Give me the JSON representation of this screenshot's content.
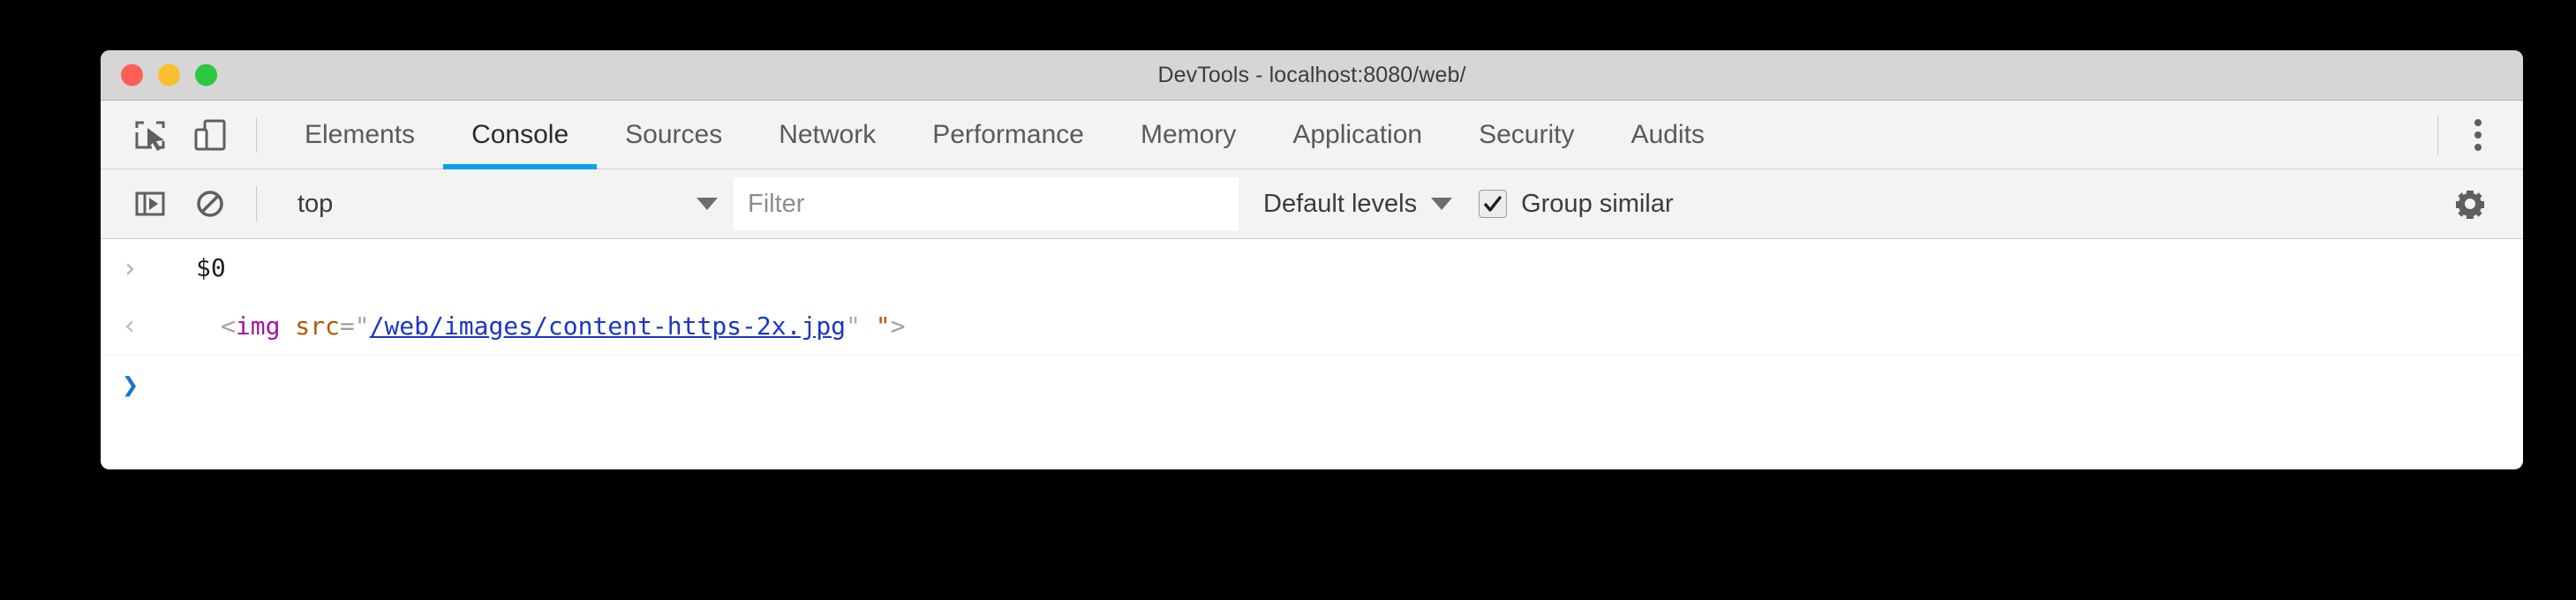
{
  "window": {
    "title": "DevTools - localhost:8080/web/",
    "traffic_lights": [
      {
        "name": "close",
        "color": "#ff5f57"
      },
      {
        "name": "minimize",
        "color": "#fbbe30"
      },
      {
        "name": "maximize",
        "color": "#2bc840"
      }
    ]
  },
  "tab_bar": {
    "icons": [
      {
        "name": "inspect-element-icon",
        "label": "Inspect element"
      },
      {
        "name": "device-toolbar-icon",
        "label": "Toggle device toolbar"
      }
    ],
    "tabs": [
      {
        "label": "Elements",
        "active": false
      },
      {
        "label": "Console",
        "active": true
      },
      {
        "label": "Sources",
        "active": false
      },
      {
        "label": "Network",
        "active": false
      },
      {
        "label": "Performance",
        "active": false
      },
      {
        "label": "Memory",
        "active": false
      },
      {
        "label": "Application",
        "active": false
      },
      {
        "label": "Security",
        "active": false
      },
      {
        "label": "Audits",
        "active": false
      }
    ],
    "more_button": "kebab-menu",
    "active_underline_color": "#0aa1e8"
  },
  "console_toolbar": {
    "sidebar_toggle": "show-console-sidebar-icon",
    "clear_console": "clear-console-icon",
    "context": {
      "value": "top",
      "caret": "chevron-down-icon"
    },
    "filter": {
      "value": "",
      "placeholder": "Filter"
    },
    "levels": {
      "value": "Default levels",
      "caret": "chevron-down-icon"
    },
    "group_similar": {
      "label": "Group similar",
      "checked": true,
      "checkmark": "✔"
    },
    "settings": "gear-icon"
  },
  "console": {
    "rows": [
      {
        "type": "input",
        "prompt": "›",
        "text": "$0"
      },
      {
        "type": "result",
        "prompt": "‹",
        "tokens": [
          {
            "cls": "tok-punct",
            "text": "<"
          },
          {
            "cls": "tok-tag",
            "text": "img"
          },
          {
            "cls": "tok-punct",
            "text": " "
          },
          {
            "cls": "tok-attr",
            "text": "src"
          },
          {
            "cls": "tok-eq",
            "text": "="
          },
          {
            "cls": "tok-quote",
            "text": "\""
          },
          {
            "cls": "tok-link",
            "text": "/web/images/content-https-2x.jpg"
          },
          {
            "cls": "tok-quote",
            "text": "\""
          },
          {
            "cls": "tok-punct",
            "text": " "
          },
          {
            "cls": "tok-quote2",
            "text": "\""
          },
          {
            "cls": "tok-punct",
            "text": ">"
          }
        ],
        "plain": "<img src=\"/web/images/content-https-2x.jpg\" \">"
      },
      {
        "type": "prompt",
        "prompt": "❯",
        "text": ""
      }
    ]
  }
}
